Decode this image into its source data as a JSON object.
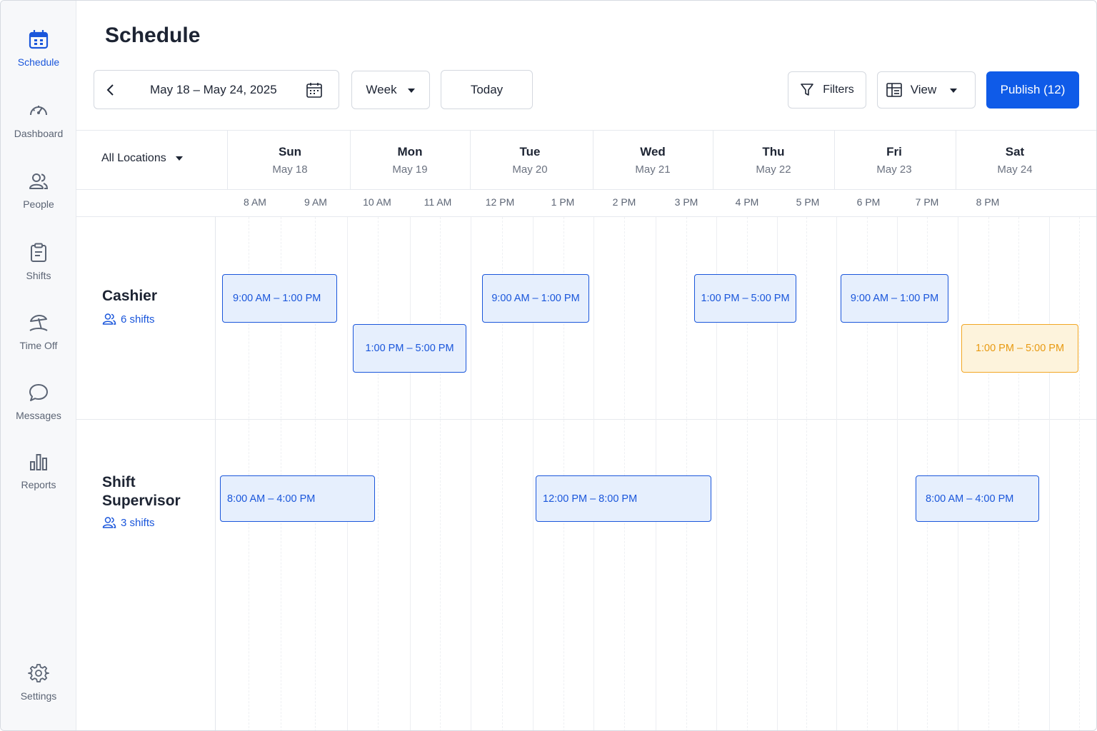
{
  "page": {
    "title": "Schedule"
  },
  "sidebar": {
    "items": [
      {
        "label": "Schedule",
        "icon": "calendar-icon",
        "active": true
      },
      {
        "label": "Dashboard",
        "icon": "gauge-icon"
      },
      {
        "label": "People",
        "icon": "people-icon"
      },
      {
        "label": "Shifts",
        "icon": "clipboard-icon"
      },
      {
        "label": "Time Off",
        "icon": "beach-umbrella-icon"
      },
      {
        "label": "Messages",
        "icon": "chat-bubble-icon"
      },
      {
        "label": "Reports",
        "icon": "bar-chart-icon"
      },
      {
        "label": "Settings",
        "icon": "gear-icon"
      }
    ]
  },
  "toolbar": {
    "date_range": "May 18 – May 24, 2025",
    "period": "Week",
    "today_label": "Today",
    "filters_label": "Filters",
    "view_label": "View",
    "publish_label": "Publish (12)"
  },
  "grid": {
    "location": "All Locations",
    "days": [
      {
        "name": "Sun",
        "date": "May 18"
      },
      {
        "name": "Mon",
        "date": "May 19"
      },
      {
        "name": "Tue",
        "date": "May 20"
      },
      {
        "name": "Wed",
        "date": "May 21"
      },
      {
        "name": "Thu",
        "date": "May 22"
      },
      {
        "name": "Fri",
        "date": "May 23"
      },
      {
        "name": "Sat",
        "date": "May 24"
      }
    ],
    "hours": [
      "8 AM",
      "9 AM",
      "10 AM",
      "11 AM",
      "12 PM",
      "1 PM",
      "2 PM",
      "3 PM",
      "4 PM",
      "5 PM",
      "6 PM",
      "7 PM",
      "8 PM"
    ]
  },
  "roles": [
    {
      "title": "Cashier",
      "count": "6 shifts",
      "shifts": [
        {
          "label": "9:00 AM – 1:00 PM",
          "status": "published"
        },
        {
          "label": "1:00 PM – 5:00 PM",
          "status": "published"
        },
        {
          "label": "9:00 AM – 1:00 PM",
          "status": "published"
        },
        {
          "label": "1:00 PM – 5:00 PM",
          "status": "published"
        },
        {
          "label": "9:00 AM – 1:00 PM",
          "status": "published"
        },
        {
          "label": "1:00 PM – 5:00 PM",
          "status": "pending"
        }
      ]
    },
    {
      "title": "Shift Supervisor",
      "count": "3 shifts",
      "shifts": [
        {
          "label": "8:00 AM – 4:00 PM",
          "status": "published"
        },
        {
          "label": "12:00 PM – 8:00 PM",
          "status": "published"
        },
        {
          "label": "8:00 AM – 4:00 PM",
          "status": "published"
        }
      ]
    }
  ],
  "colors": {
    "accent": "#0f5be8",
    "shift_border": "#1a56db",
    "shift_fill": "#e6effd",
    "pending_border": "#f2a623",
    "pending_fill": "#fdf3dc"
  }
}
